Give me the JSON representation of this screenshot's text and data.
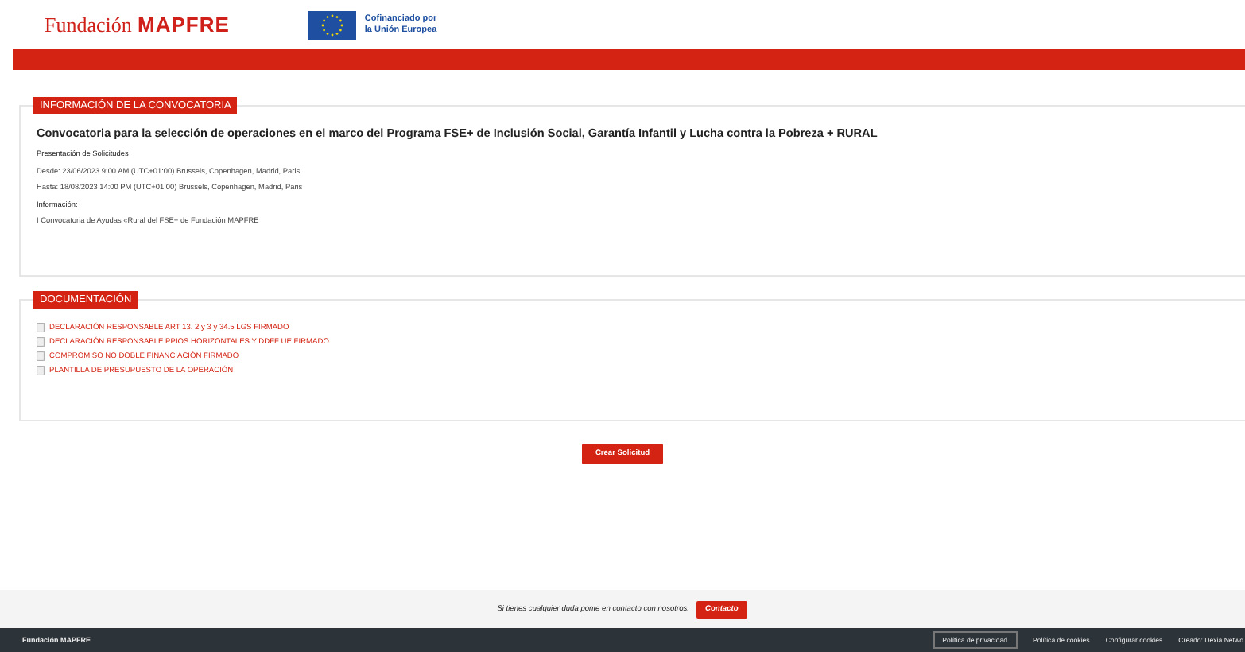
{
  "header": {
    "logo_light": "Fundación",
    "logo_bold": "MAPFRE",
    "eu_badge": [
      "Cofinanciado por",
      "la Unión Europea"
    ]
  },
  "info": {
    "heading": "INFORMACIÓN DE LA CONVOCATORIA",
    "title": "Convocatoria para la selección de operaciones en el marco del Programa FSE+ de Inclusión Social, Garantía Infantil y Lucha contra la Pobreza + RURAL",
    "lines": [
      {
        "kind": "label",
        "text": "Presentación de Solicitudes"
      },
      {
        "kind": "text",
        "text": "Desde: 23/06/2023 9:00 AM (UTC+01:00) Brussels, Copenhagen, Madrid, Paris"
      },
      {
        "kind": "text",
        "text": "Hasta: 18/08/2023 14:00 PM (UTC+01:00) Brussels, Copenhagen, Madrid, Paris"
      },
      {
        "kind": "label",
        "text": "Información:"
      },
      {
        "kind": "text",
        "text": "I Convocatoria de Ayudas «Rural del FSE+ de Fundación MAPFRE"
      }
    ]
  },
  "documents": {
    "heading": "DOCUMENTACIÓN",
    "items": [
      "DECLARACIÓN RESPONSABLE ART 13. 2 y 3 y 34.5 LGS FIRMADO",
      "DECLARACIÓN RESPONSABLE PPIOS HORIZONTALES Y DDFF UE FIRMADO",
      "COMPROMISO NO DOBLE FINANCIACIÓN FIRMADO",
      "PLANTILLA DE PRESUPUESTO DE LA OPERACIÓN"
    ]
  },
  "create_button": "Crear Solicitud",
  "contact_bar": {
    "text": "Si tienes cualquier duda ponte en contacto con nosotros:",
    "button": "Contacto"
  },
  "footer": {
    "brand": "Fundación MAPFRE",
    "links": [
      {
        "kind": "button",
        "text": "Política de privacidad"
      },
      {
        "kind": "link",
        "text": "Política de cookies"
      },
      {
        "kind": "link",
        "text": "Configurar cookies"
      },
      {
        "kind": "link",
        "text": "Creado: Dexia Netwo"
      }
    ]
  }
}
